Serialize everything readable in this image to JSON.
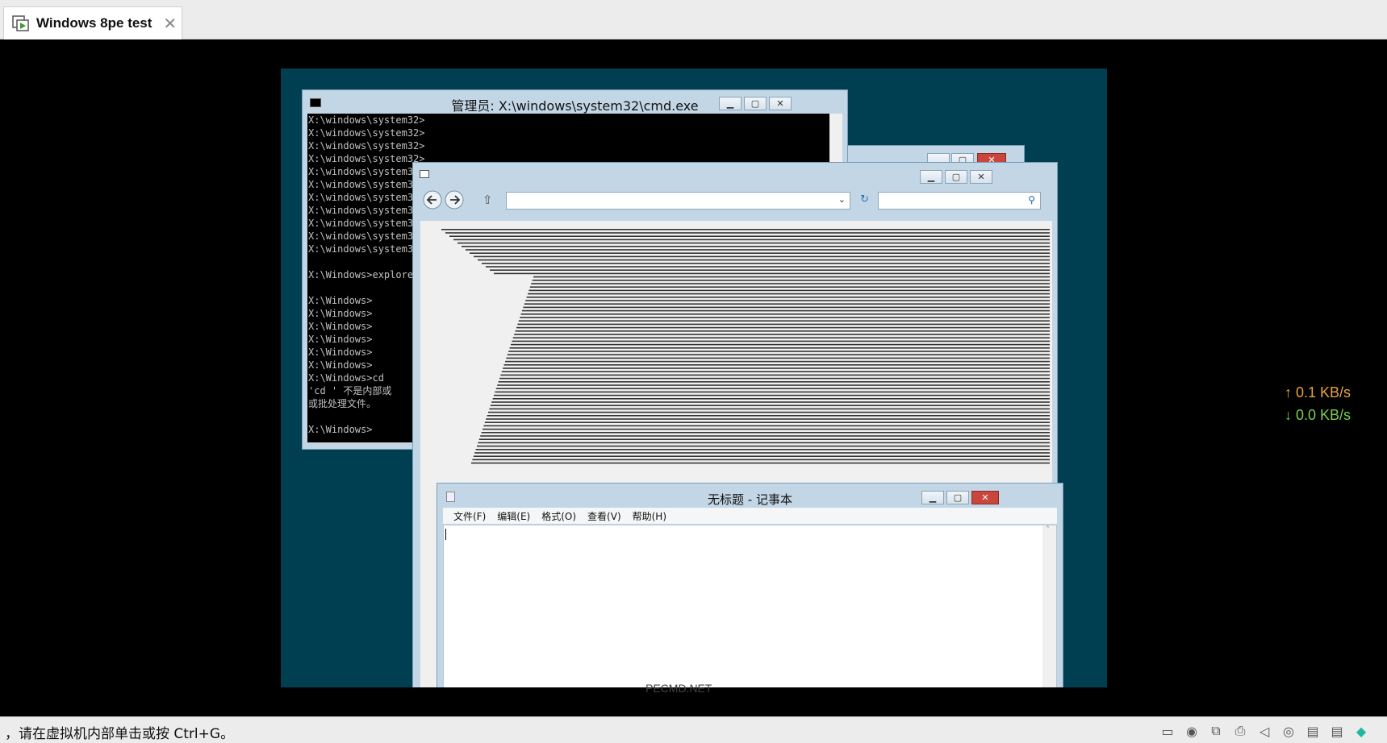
{
  "tab": {
    "title": "Windows 8pe test"
  },
  "cmd": {
    "title": "管理员: X:\\windows\\system32\\cmd.exe",
    "lines": [
      "X:\\windows\\system32>",
      "X:\\windows\\system32>",
      "X:\\windows\\system32>",
      "X:\\windows\\system32>",
      "X:\\windows\\system32>",
      "X:\\windows\\system32>",
      "X:\\windows\\system32>",
      "X:\\windows\\system32>",
      "X:\\windows\\system32>",
      "X:\\windows\\system32>",
      "X:\\windows\\system32>",
      "",
      "X:\\Windows>explorer",
      "",
      "X:\\Windows>",
      "X:\\Windows>",
      "X:\\Windows>",
      "X:\\Windows>",
      "X:\\Windows>",
      "X:\\Windows>",
      "X:\\Windows>cd",
      "'cd ' 不是内部或",
      "或批处理文件。",
      "",
      "X:\\Windows>"
    ]
  },
  "notepad": {
    "title": "无标题 - 记事本",
    "menu": [
      "文件(F)",
      "编辑(E)",
      "格式(O)",
      "查看(V)",
      "帮助(H)"
    ]
  },
  "watermark": "PECMD.NET",
  "network": {
    "up": "↑ 0.1 KB/s",
    "down": "↓ 0.0 KB/s"
  },
  "status": {
    "hint": "，请在虚拟机内部单击或按 Ctrl+G。"
  },
  "devices": [
    {
      "name": "hdd-icon",
      "glyph": "▭"
    },
    {
      "name": "cd-icon",
      "glyph": "◉"
    },
    {
      "name": "network-icon",
      "glyph": "⧉"
    },
    {
      "name": "printer-icon",
      "glyph": "⎙"
    },
    {
      "name": "sound-icon",
      "glyph": "◁"
    },
    {
      "name": "usb-icon",
      "glyph": "◎"
    },
    {
      "name": "display-icon",
      "glyph": "▤"
    },
    {
      "name": "storage-icon",
      "glyph": "▤"
    },
    {
      "name": "message-icon",
      "glyph": "◆"
    }
  ]
}
